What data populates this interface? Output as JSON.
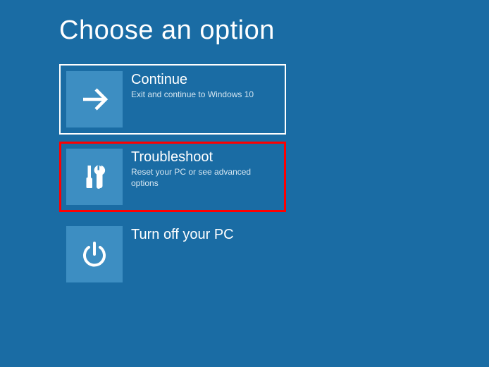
{
  "page": {
    "title": "Choose an option"
  },
  "options": {
    "continue": {
      "title": "Continue",
      "desc": "Exit and continue to Windows 10"
    },
    "troubleshoot": {
      "title": "Troubleshoot",
      "desc": "Reset your PC or see advanced options"
    },
    "turnoff": {
      "title": "Turn off your PC",
      "desc": ""
    }
  }
}
